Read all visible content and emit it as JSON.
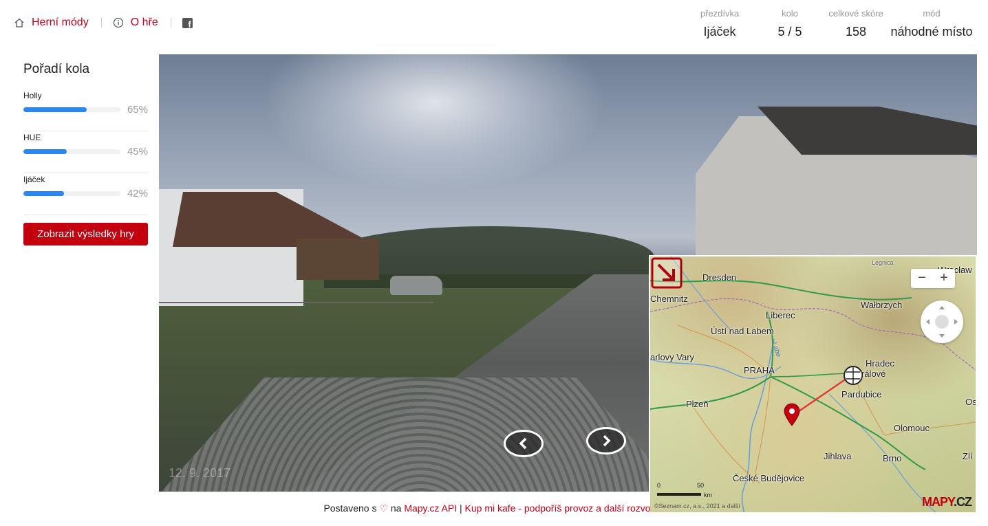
{
  "nav": {
    "modes_label": "Herní módy",
    "about_label": "O hře"
  },
  "stats": {
    "nickname": {
      "label": "přezdívka",
      "value": "Ijáček"
    },
    "round": {
      "label": "kolo",
      "value": "5 / 5"
    },
    "score": {
      "label": "celkové skóre",
      "value": "158"
    },
    "mode": {
      "label": "mód",
      "value": "náhodné místo"
    }
  },
  "sidebar": {
    "title": "Pořadí kola",
    "players": [
      {
        "name": "Holly",
        "percent": "65%",
        "fill": 0.65
      },
      {
        "name": "HUE",
        "percent": "45%",
        "fill": 0.45
      },
      {
        "name": "Ijáček",
        "percent": "42%",
        "fill": 0.42
      }
    ],
    "results_button": "Zobrazit výsledky hry"
  },
  "panorama": {
    "date": "12. 9. 2017"
  },
  "map": {
    "labels": {
      "legnica": "Legnica",
      "wroclaw": "Wrocław",
      "dresden": "Dresden",
      "chemnitz": "Chemnitz",
      "walbrzych": "Wałbrzych",
      "liberec": "Liberec",
      "usti": "Ústí nad Labem",
      "karlovy": "arlovy Vary",
      "labe": "Labe",
      "praha": "PRAHA",
      "hradec1": "Hradec",
      "hradec2": "rálové",
      "pardubice": "Pardubice",
      "plzen": "Plzeň",
      "olomouc": "Olomouc",
      "jihlava": "Jihlava",
      "brno": "Brno",
      "budejovice": "České Budějovice",
      "os": "Os",
      "zli": "Zlí"
    },
    "zoom_out": "−",
    "zoom_in": "+",
    "scale_0": "0",
    "scale_50": "50",
    "scale_unit": "km",
    "copyright": "©Seznam.cz, a.s., 2021 a další",
    "logo_main": "MAPY",
    "logo_suffix": ".CZ"
  },
  "footer": {
    "built_text": "Postaveno s",
    "on_text": "na",
    "api_link": "Mapy.cz API",
    "separator": "|",
    "coffee_link": "Kup mi kafe - podpoříš provoz a další rozvo"
  },
  "colors": {
    "accent": "#c4001a",
    "progress": "#2b87f0",
    "button": "#c4000f"
  }
}
